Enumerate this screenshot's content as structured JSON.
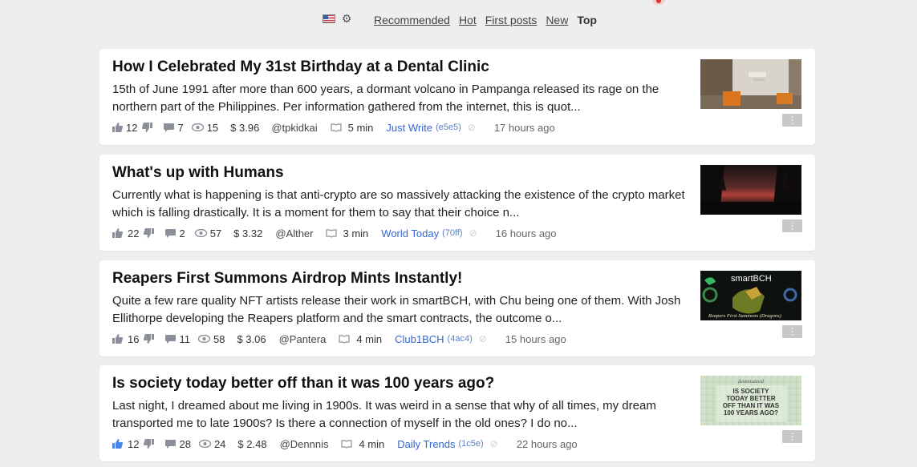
{
  "nav": {
    "flag_icon": "us-flag-icon",
    "settings_icon": "gear-icon",
    "tabs": [
      {
        "label": "Recommended",
        "active": false
      },
      {
        "label": "Hot",
        "active": false
      },
      {
        "label": "First posts",
        "active": false
      },
      {
        "label": "New",
        "active": false
      },
      {
        "label": "Top",
        "active": true
      }
    ]
  },
  "colors": {
    "accent": "#3367d6",
    "background": "#eeeef0",
    "card": "#ffffff"
  },
  "posts": [
    {
      "title": "How I Celebrated My 31st Birthday at a Dental Clinic",
      "excerpt": "15th of June 1991 after more than 600 years, a dormant volcano in Pampanga released its rage on the northern part of the Philippines. Per information gathered from the internet, this is quot...",
      "likes": "12",
      "comments": "7",
      "views": "15",
      "earnings": "$ 3.96",
      "author": "@tpkidkai",
      "read_time": "5 min",
      "community": "Just Write",
      "community_code": "(e5e5)",
      "time": "17 hours ago",
      "thumb": "dental-clinic-photo"
    },
    {
      "title": "What's up with Humans",
      "excerpt": "Currently what is happening is that anti-crypto are so massively attacking the existence of the crypto market which is falling drastically. It is a moment for them to say that their choice n...",
      "likes": "22",
      "comments": "2",
      "views": "57",
      "earnings": "$ 3.32",
      "author": "@Alther",
      "read_time": "3 min",
      "community": "World Today",
      "community_code": "(70ff)",
      "time": "16 hours ago",
      "thumb": "sunset-forest-photo"
    },
    {
      "title": "Reapers First Summons Airdrop Mints Instantly!",
      "excerpt": "Quite a few rare quality NFT artists release their work in smartBCH, with  Chu  being one of them. With Josh Ellithorpe developing the Reapers platform and the smart contracts, the outcome o...",
      "likes": "16",
      "comments": "11",
      "views": "58",
      "earnings": "$ 3.06",
      "author": "@Pantera",
      "read_time": "4 min",
      "community": "Club1BCH",
      "community_code": "(4ac4)",
      "time": "15 hours ago",
      "thumb": "smartbch-banner",
      "thumb_text": [
        "smartBCH",
        "Reapers First Summons (Dragons)"
      ]
    },
    {
      "title": "Is society today better off than it was 100 years ago?",
      "excerpt": "Last night, I dreamed about me living in 1900s. It was weird in a sense that why of all times, my dream transported me to late 1900s? Is there a connection of myself in the old ones? I do no...",
      "likes": "12",
      "comments": "28",
      "views": "24",
      "earnings": "$ 2.48",
      "author": "@Dennnis",
      "read_time": "4 min",
      "community": "Daily Trends",
      "community_code": "(1c5e)",
      "time": "22 hours ago",
      "thumb": "society-question-card",
      "thumb_text": [
        "dennnisdavid",
        "IS SOCIETY",
        "TODAY BETTER",
        "OFF THAN IT WAS",
        "100 YEARS AGO?"
      ]
    }
  ]
}
